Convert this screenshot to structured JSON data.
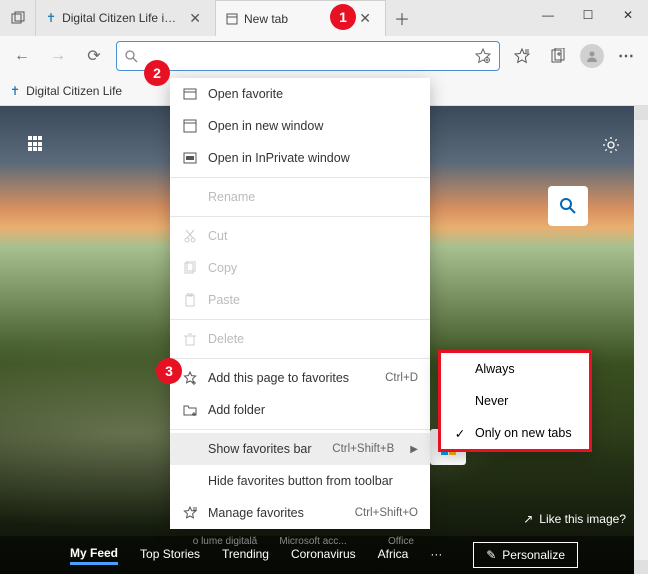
{
  "window": {
    "minimize": "—",
    "maximize": "☐",
    "close": "✕"
  },
  "tabs": {
    "inactive_title": "Digital Citizen Life in a digital wo",
    "active_title": "New tab",
    "close_glyph": "✕",
    "add_glyph": "＋"
  },
  "toolbar": {
    "back": "←",
    "forward": "→",
    "refresh": "⟳",
    "menu_dots": "⋯"
  },
  "favorites_bar": {
    "item1": "Digital Citizen Life"
  },
  "context_menu": {
    "open_favorite": "Open favorite",
    "open_new_window": "Open in new window",
    "open_inprivate": "Open in InPrivate window",
    "rename": "Rename",
    "cut": "Cut",
    "copy": "Copy",
    "paste": "Paste",
    "delete": "Delete",
    "add_page": "Add this page to favorites",
    "add_page_shortcut": "Ctrl+D",
    "add_folder": "Add folder",
    "show_fav_bar": "Show favorites bar",
    "show_fav_bar_shortcut": "Ctrl+Shift+B",
    "hide_fav_button": "Hide favorites button from toolbar",
    "manage_fav": "Manage favorites",
    "manage_fav_shortcut": "Ctrl+Shift+O"
  },
  "submenu": {
    "always": "Always",
    "never": "Never",
    "only_new": "Only on new tabs"
  },
  "newtab_page": {
    "tiles": [
      "o lume digitală",
      "Microsoft acc...",
      "Office"
    ],
    "like_image": "Like this image?",
    "feed": [
      "My Feed",
      "Top Stories",
      "Trending",
      "Coronavirus",
      "Africa"
    ],
    "feed_more": "···",
    "personalize": "Personalize"
  },
  "badges": {
    "b1": "1",
    "b2": "2",
    "b3": "3"
  }
}
